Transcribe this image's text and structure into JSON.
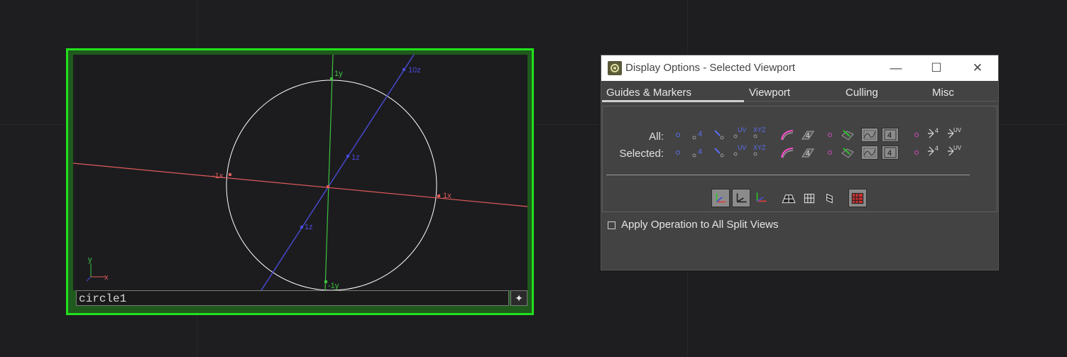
{
  "viewport": {
    "node_name": "circle1",
    "pin_icon": "pin-icon",
    "axis_labels": {
      "pos_y": "1y",
      "neg_y": "-1y",
      "pos_x": "1x",
      "neg_x": "-1x",
      "pos_z": "1z",
      "neg_z": "1z",
      "far_z": "10z"
    },
    "gnomon": {
      "y": "y",
      "x": "x"
    },
    "colors": {
      "frame": "#22e01c",
      "x_axis": "#e05a5a",
      "y_axis": "#3fc23f",
      "z_axis": "#4a4ad8",
      "circle": "#ffffff"
    }
  },
  "dialog": {
    "title": "Display Options - Selected Viewport",
    "window_buttons": [
      "minimize-icon",
      "maximize-icon",
      "close-icon"
    ],
    "tabs": [
      "Guides & Markers",
      "Viewport",
      "Culling",
      "Misc"
    ],
    "active_tab": "Guides & Markers",
    "rows": [
      {
        "label": "All:"
      },
      {
        "label": "Selected:"
      }
    ],
    "icon_glyphs": {
      "uv": "UV",
      "xyz": "XYZ",
      "four": "4"
    },
    "apply_option": {
      "label": "Apply Operation to All Split Views",
      "checked": false
    }
  }
}
